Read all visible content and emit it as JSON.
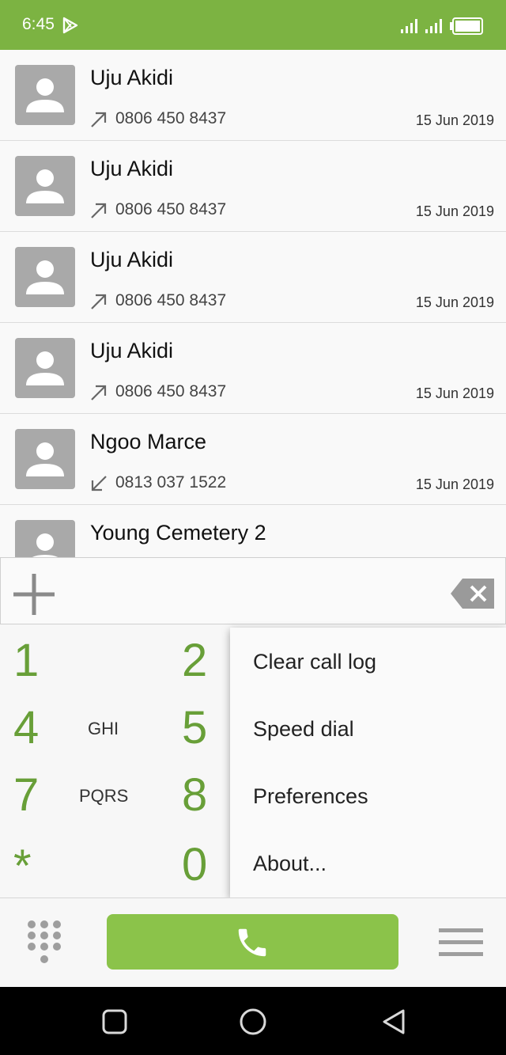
{
  "status_bar": {
    "time": "6:45",
    "color": "#7cb342",
    "icons": [
      "play-store-notification-icon",
      "signal-icon",
      "signal-icon",
      "battery-icon"
    ]
  },
  "call_log": [
    {
      "name": "Uju Akidi",
      "number": "0806 450 8437",
      "date": "15 Jun 2019",
      "direction": "outgoing"
    },
    {
      "name": "Uju Akidi",
      "number": "0806 450 8437",
      "date": "15 Jun 2019",
      "direction": "outgoing"
    },
    {
      "name": "Uju Akidi",
      "number": "0806 450 8437",
      "date": "15 Jun 2019",
      "direction": "outgoing"
    },
    {
      "name": "Uju Akidi",
      "number": "0806 450 8437",
      "date": "15 Jun 2019",
      "direction": "outgoing"
    },
    {
      "name": "Ngoo Marce",
      "number": "0813 037 1522",
      "date": "15 Jun 2019",
      "direction": "incoming"
    },
    {
      "name": "Young Cemetery 2",
      "number": "",
      "date": "",
      "direction": ""
    }
  ],
  "dialer_input": {
    "value": ""
  },
  "dialpad": {
    "keys": [
      {
        "digit": "1",
        "letters": ""
      },
      {
        "digit": "2",
        "letters": ""
      },
      {
        "digit": "4",
        "letters": "GHI"
      },
      {
        "digit": "5",
        "letters": ""
      },
      {
        "digit": "7",
        "letters": "PQRS"
      },
      {
        "digit": "8",
        "letters": ""
      },
      {
        "digit": "*",
        "letters": ""
      },
      {
        "digit": "0",
        "letters": ""
      }
    ],
    "accent_color": "#689f38"
  },
  "overflow_menu": {
    "items": [
      "Clear call log",
      "Speed dial",
      "Preferences",
      "About..."
    ]
  },
  "bottom_bar": {
    "call_button_color": "#8bc34a",
    "icons": [
      "dialpad-icon",
      "phone-icon",
      "menu-icon"
    ]
  },
  "nav_bar": {
    "icons": [
      "recents-icon",
      "home-icon",
      "back-icon"
    ]
  }
}
